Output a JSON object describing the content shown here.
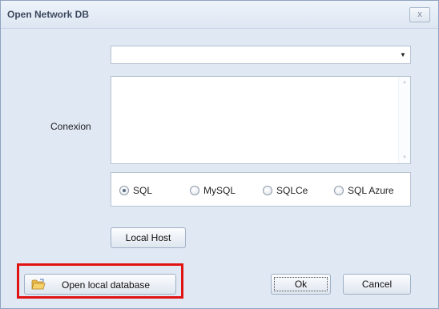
{
  "window": {
    "title": "Open Network DB",
    "close_label": "x"
  },
  "connection": {
    "combo_value": "",
    "label": "Conexion",
    "memo_value": ""
  },
  "db_types": {
    "options": [
      "SQL",
      "MySQL",
      "SQLCe",
      "SQL Azure"
    ],
    "selected": "SQL"
  },
  "buttons": {
    "local_host": "Local Host",
    "open_local_database": "Open local database",
    "ok": "Ok",
    "cancel": "Cancel"
  },
  "colors": {
    "highlight": "#e01212",
    "background": "#dfe8f3"
  }
}
